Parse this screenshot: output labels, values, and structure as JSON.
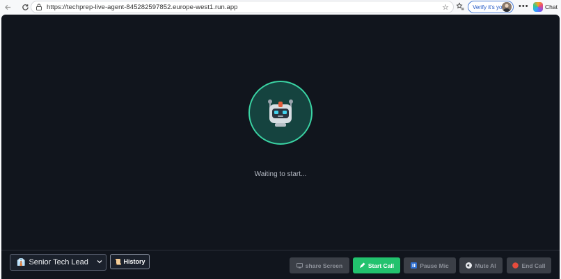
{
  "browser": {
    "url": "https://techprep-live-agent-845282597852.europe-west1.run.app",
    "verify_label": "Verify it's you",
    "chat_label": "Chat",
    "more_label": "•••"
  },
  "main": {
    "status_text": "Waiting to start..."
  },
  "controls": {
    "role_select": {
      "emoji": "👔",
      "selected": "Senior Tech Lead"
    },
    "history": {
      "icon": "📜",
      "label": "History"
    },
    "share_screen": {
      "label": "share Screen",
      "enabled": false
    },
    "start_call": {
      "label": "Start Call",
      "enabled": true
    },
    "pause_mic": {
      "label": "Pause Mic",
      "enabled": false
    },
    "mute_ai": {
      "label": "Mute AI",
      "enabled": false
    },
    "end_call": {
      "label": "End Call",
      "enabled": false
    }
  },
  "colors": {
    "app_bg": "#11151d",
    "accent": "#3ad3a3",
    "primary_button": "#22c26e",
    "disabled_button": "#3b3f47"
  }
}
